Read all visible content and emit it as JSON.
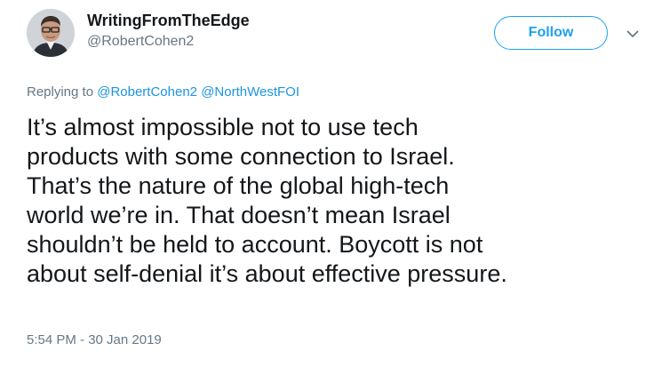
{
  "author": {
    "display_name": "WritingFromTheEdge",
    "handle": "@RobertCohen2",
    "avatar_icon": "profile-photo"
  },
  "actions": {
    "follow_label": "Follow",
    "more_icon": "chevron-down-icon"
  },
  "reply_context": {
    "prefix": "Replying to",
    "mentions": [
      "@RobertCohen2",
      "@NorthWestFOI"
    ]
  },
  "tweet": {
    "lines": [
      "It’s almost impossible not to use tech",
      "products with some connection to Israel.",
      "That’s the nature of the global high-tech",
      "world we’re in. That doesn’t mean Israel",
      "shouldn’t be held to account. Boycott is not",
      "about self-denial it’s about effective pressure."
    ],
    "timestamp": "5:54 PM - 30 Jan 2019"
  },
  "colors": {
    "accent": "#1da1f2",
    "link": "#1b95e0",
    "secondary_text": "#657786",
    "primary_text": "#14171a"
  }
}
